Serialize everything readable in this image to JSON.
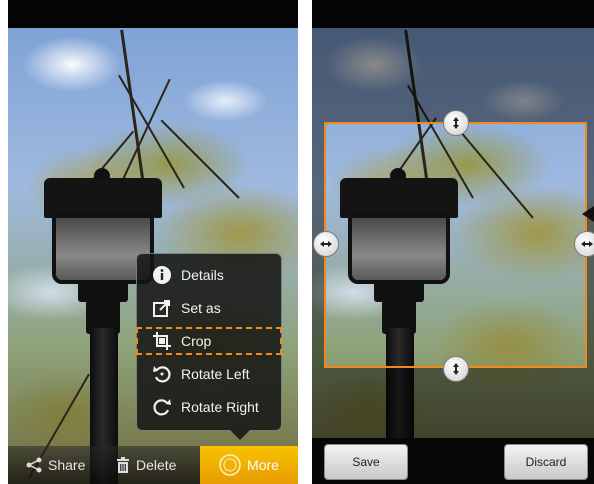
{
  "left_screen": {
    "action_bar": {
      "share_label": "Share",
      "delete_label": "Delete",
      "more_label": "More"
    },
    "menu": {
      "items": [
        {
          "label": "Details",
          "icon": "info-icon"
        },
        {
          "label": "Set as",
          "icon": "set-as-icon"
        },
        {
          "label": "Crop",
          "icon": "crop-icon",
          "highlighted": true
        },
        {
          "label": "Rotate Left",
          "icon": "rotate-left-icon"
        },
        {
          "label": "Rotate Right",
          "icon": "rotate-right-icon"
        }
      ]
    }
  },
  "right_screen": {
    "buttons": {
      "save_label": "Save",
      "discard_label": "Discard"
    }
  },
  "colors": {
    "accent": "#f08a1d",
    "more_button": "#f7b400",
    "menu_background": "#141414"
  }
}
